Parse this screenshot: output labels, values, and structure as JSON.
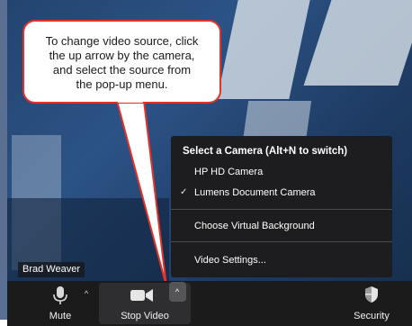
{
  "callout": {
    "lines": [
      "To change video source, click",
      "the up arrow by the camera,",
      "and select the source from",
      "the pop-up menu."
    ]
  },
  "participant": {
    "name": "Brad Weaver"
  },
  "camera_menu": {
    "header": "Select a Camera (Alt+N to switch)",
    "cameras": [
      {
        "label": "HP HD Camera",
        "selected": false
      },
      {
        "label": "Lumens Document Camera",
        "selected": true
      }
    ],
    "virtual_background": "Choose Virtual Background",
    "video_settings": "Video Settings..."
  },
  "toolbar": {
    "mute_label": "Mute",
    "stop_video_label": "Stop Video",
    "security_label": "Security",
    "caret_glyph": "^",
    "check_glyph": "✓"
  },
  "colors": {
    "callout_border": "#e0332c",
    "toolbar_bg": "#1b1b1c",
    "menu_bg": "#1d1d1f"
  }
}
